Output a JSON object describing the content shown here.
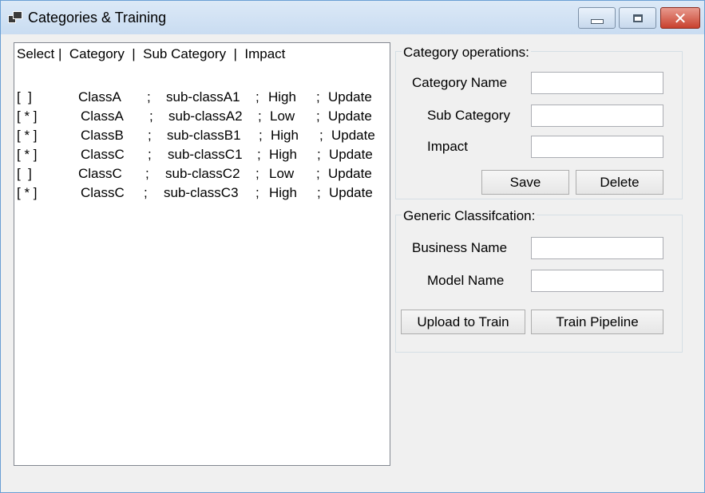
{
  "window": {
    "title": "Categories & Training",
    "buttons": {
      "minimize": "minimize",
      "maximize": "maximize",
      "close": "close"
    }
  },
  "list": {
    "header": "Select |  Category  |  Sub Category  |  Impact",
    "rows": [
      {
        "select": "[  ]",
        "category": "ClassA",
        "sub": "sub-classA1",
        "impact": "High",
        "action": "Update"
      },
      {
        "select": "[ * ]",
        "category": "ClassA",
        "sub": "sub-classA2",
        "impact": "Low",
        "action": "Update"
      },
      {
        "select": "[ * ]",
        "category": "ClassB",
        "sub": "sub-classB1",
        "impact": "High",
        "action": "Update"
      },
      {
        "select": "[ * ]",
        "category": "ClassC",
        "sub": "sub-classC1",
        "impact": "High",
        "action": "Update"
      },
      {
        "select": "[  ]",
        "category": "ClassC",
        "sub": "sub-classC2",
        "impact": "Low",
        "action": "Update"
      },
      {
        "select": "[ * ]",
        "category": "ClassC",
        "sub": "sub-classC3",
        "impact": "High",
        "action": "Update"
      }
    ]
  },
  "category_ops": {
    "legend": "Category operations:",
    "name_label": "Category Name",
    "name_value": "",
    "sub_label": "Sub Category",
    "sub_value": "",
    "impact_label": "Impact",
    "impact_value": "",
    "save_label": "Save",
    "delete_label": "Delete"
  },
  "generic": {
    "legend": "Generic Classifcation:",
    "business_label": "Business Name",
    "business_value": "",
    "model_label": "Model Name",
    "model_value": "",
    "upload_label": "Upload to Train",
    "pipeline_label": "Train Pipeline"
  },
  "colors": {
    "title_bar": "#c9dcf1",
    "close_button": "#c8412e",
    "form_background": "#f0f0f0"
  }
}
